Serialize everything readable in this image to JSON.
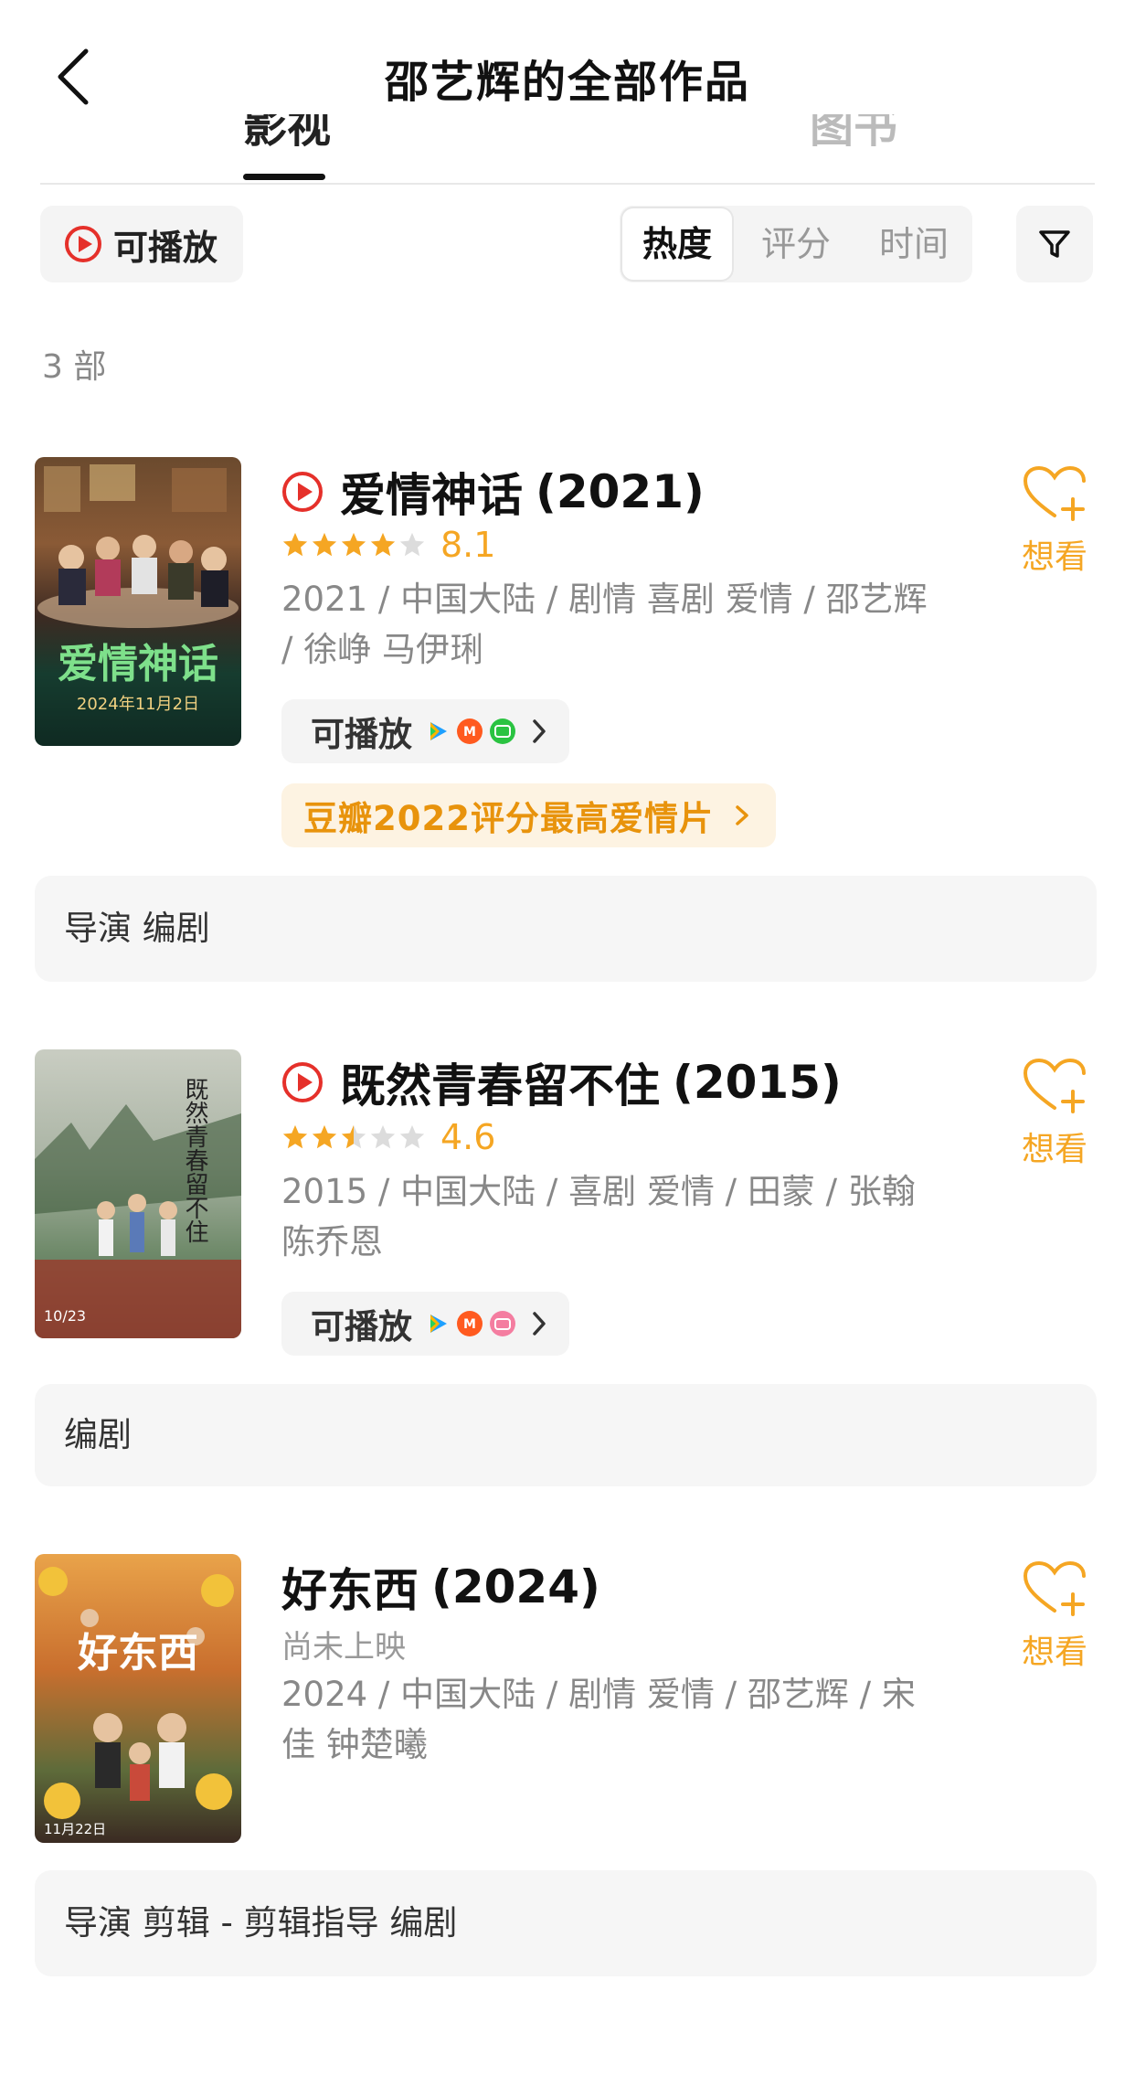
{
  "header": {
    "title": "邵艺辉的全部作品",
    "back_icon": "chevron-left-icon"
  },
  "tabs": [
    {
      "label": "影视",
      "active": true
    },
    {
      "label": "图书",
      "active": false
    }
  ],
  "filters": {
    "playable_label": "可播放",
    "sort_options": [
      "热度",
      "评分",
      "时间"
    ],
    "active_sort": "热度",
    "filter_icon": "funnel-icon"
  },
  "count_label": "3 部",
  "colors": {
    "accent": "#f5a623",
    "play_red": "#e5302a",
    "honor_bg": "#fdf3e2",
    "honor_text": "#e8930c"
  },
  "movies": [
    {
      "title": "爱情神话",
      "year": "(2021)",
      "playable_icon": true,
      "rating": {
        "stars": 4,
        "score": "8.1"
      },
      "meta": "2021 / 中国大陆 / 剧情 喜剧 爱情 / 邵艺辉 / 徐峥 马伊琍",
      "playable_label": "可播放",
      "platforms": [
        "tencent-video",
        "mango-tv",
        "iqiyi"
      ],
      "honor": "豆瓣2022评分最高爱情片",
      "want_label": "想看",
      "roles": "导演 编剧",
      "poster_text": [
        "爱情神话",
        "2024年11月2日"
      ]
    },
    {
      "title": "既然青春留不住",
      "year": "(2015)",
      "playable_icon": true,
      "rating": {
        "stars": 2.5,
        "score": "4.6"
      },
      "meta": "2015 / 中国大陆 / 喜剧 爱情 / 田蒙 / 张翰 陈乔恩",
      "playable_label": "可播放",
      "platforms": [
        "tencent-video",
        "mango-tv",
        "bilibili"
      ],
      "want_label": "想看",
      "roles": "编剧",
      "poster_text": [
        "既然青春留不住",
        "10/23"
      ]
    },
    {
      "title": "好东西",
      "year": "(2024)",
      "playable_icon": false,
      "status": "尚未上映",
      "meta": "2024 / 中国大陆 / 剧情 爱情 / 邵艺辉 / 宋佳 钟楚曦",
      "want_label": "想看",
      "roles": "导演 剪辑 - 剪辑指导 编剧",
      "poster_text": [
        "好东西",
        "11月22日"
      ]
    }
  ]
}
